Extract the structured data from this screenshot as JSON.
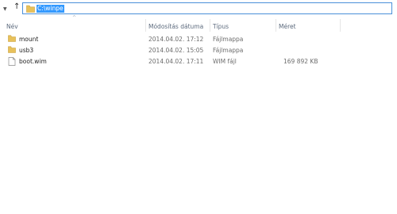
{
  "address": {
    "path": "C:\\winpe"
  },
  "columns": {
    "name": "Név",
    "modified": "Módosítás dátuma",
    "type": "Típus",
    "size": "Méret"
  },
  "files": [
    {
      "name": "mount",
      "modified": "2014.04.02. 17:12",
      "type": "Fájlmappa",
      "size": "",
      "icon": "folder-icon"
    },
    {
      "name": "usb3",
      "modified": "2014.04.02. 15:05",
      "type": "Fájlmappa",
      "size": "",
      "icon": "folder-icon"
    },
    {
      "name": "boot.wim",
      "modified": "2014.04.02. 17:11",
      "type": "WIM fájl",
      "size": "169 892 KB",
      "icon": "file-icon"
    }
  ],
  "colors": {
    "selection": "#3399ff",
    "folder": "#e8c15a",
    "header_text": "#5c6a7d"
  }
}
